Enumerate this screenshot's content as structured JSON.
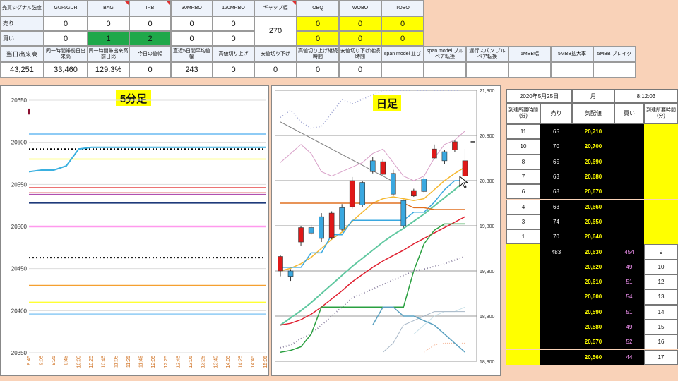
{
  "signal_table": {
    "col_headers": [
      "売買シグナル強度",
      "GUR/GDR",
      "BAG",
      "IRB",
      "30MRBO",
      "120MRBO",
      "ギャップ幅",
      "OBQ",
      "WOBO",
      "TOBO"
    ],
    "sell_label": "売り",
    "buy_label": "買い",
    "sell_values": [
      "0",
      "0",
      "0",
      "0",
      "0",
      "0",
      "0",
      "0"
    ],
    "buy_values": [
      "0",
      "1",
      "2",
      "0",
      "0",
      "0",
      "0",
      "0"
    ],
    "gap_value": "270",
    "row3_headers": [
      "当日出来高",
      "同一時間帯前日出来高",
      "同一時間帯出来高前日比",
      "今日の値幅",
      "直近5日間平均値幅",
      "高値切り上げ",
      "安値切り下げ",
      "高値切り上げ継続時間",
      "安値切り下げ継続時間",
      "span model 並び",
      "span model ブルベア転換",
      "遅行スパン ブルベア転換",
      "5MBB幅",
      "5MBB拡大率",
      "5MBB ブレイク"
    ],
    "row4_values": [
      "43,251",
      "33,460",
      "129.3%",
      "0",
      "243",
      "0",
      "0",
      "0",
      "0",
      "",
      "",
      "",
      "",
      "",
      ""
    ]
  },
  "chart5": {
    "title": "5分足",
    "y_ticks": [
      "20650",
      "20600",
      "20550",
      "20500",
      "20450",
      "20400",
      "20350"
    ],
    "x_ticks": [
      "8:45",
      "9:05",
      "9:25",
      "9:45",
      "10:05",
      "10:25",
      "10:45",
      "11:05",
      "11:25",
      "11:45",
      "12:05",
      "12:25",
      "12:45",
      "13:05",
      "13:25",
      "13:45",
      "14:05",
      "14:25",
      "14:45",
      "15:05"
    ],
    "ylim": [
      20350,
      20650
    ],
    "price_line": [
      [
        0,
        20565
      ],
      [
        1,
        20567
      ],
      [
        2,
        20567
      ],
      [
        3,
        20572
      ],
      [
        4,
        20592
      ],
      [
        5,
        20594
      ],
      [
        19,
        20594
      ]
    ],
    "levels": [
      {
        "y": 20610,
        "color": "#8ecbf5",
        "width": 3,
        "dash": ""
      },
      {
        "y": 20592,
        "color": "#000000",
        "width": 2,
        "dash": "2,3"
      },
      {
        "y": 20580,
        "color": "#ffff33",
        "width": 1.5,
        "dash": ""
      },
      {
        "y": 20546,
        "color": "#e02020",
        "width": 1.5,
        "dash": ""
      },
      {
        "y": 20540,
        "color": "#e07070",
        "width": 1.5,
        "dash": ""
      },
      {
        "y": 20538,
        "color": "#b050b0",
        "width": 1.5,
        "dash": ""
      },
      {
        "y": 20528,
        "color": "#1f3a7a",
        "width": 2,
        "dash": ""
      },
      {
        "y": 20500,
        "color": "#ff99ee",
        "width": 2.5,
        "dash": ""
      },
      {
        "y": 20463,
        "color": "#000000",
        "width": 2,
        "dash": "2,3"
      },
      {
        "y": 20430,
        "color": "#f5a030",
        "width": 1.5,
        "dash": ""
      },
      {
        "y": 20410,
        "color": "#ffff33",
        "width": 1.5,
        "dash": ""
      },
      {
        "y": 20396,
        "color": "#8ecbf5",
        "width": 1.5,
        "dash": ""
      }
    ]
  },
  "chart_day": {
    "title": "日足",
    "y_ticks": [
      "21,300",
      "20,800",
      "20,300",
      "19,800",
      "19,300",
      "18,800",
      "18,300"
    ],
    "ylim": [
      18300,
      21300
    ],
    "candles": [
      {
        "o": 19300,
        "c": 19460,
        "h": 19480,
        "l": 19240
      },
      {
        "o": 19300,
        "c": 19240,
        "h": 19320,
        "l": 19190
      },
      {
        "o": 19620,
        "c": 19780,
        "h": 19800,
        "l": 19580
      },
      {
        "o": 19780,
        "c": 19720,
        "h": 19810,
        "l": 19700
      },
      {
        "o": 19900,
        "c": 19660,
        "h": 19940,
        "l": 19620
      },
      {
        "o": 19670,
        "c": 19940,
        "h": 19960,
        "l": 19650
      },
      {
        "o": 20000,
        "c": 19760,
        "h": 20040,
        "l": 19740
      },
      {
        "o": 20010,
        "c": 20300,
        "h": 20340,
        "l": 19990
      },
      {
        "o": 20280,
        "c": 20030,
        "h": 20300,
        "l": 20010
      },
      {
        "o": 20520,
        "c": 20400,
        "h": 20560,
        "l": 20380
      },
      {
        "o": 20370,
        "c": 20510,
        "h": 20540,
        "l": 20350
      },
      {
        "o": 20380,
        "c": 20150,
        "h": 20420,
        "l": 20130
      },
      {
        "o": 20080,
        "c": 19800,
        "h": 20090,
        "l": 19780
      },
      {
        "o": 20130,
        "c": 20190,
        "h": 20210,
        "l": 20120
      },
      {
        "o": 20320,
        "c": 20180,
        "h": 20340,
        "l": 20170
      },
      {
        "o": 20550,
        "c": 20650,
        "h": 20700,
        "l": 20540
      },
      {
        "o": 20620,
        "c": 20520,
        "h": 20640,
        "l": 20480
      },
      {
        "o": 20640,
        "c": 20730,
        "h": 20750,
        "l": 20620
      },
      {
        "o": 20350,
        "c": 20520,
        "h": 20650,
        "l": 20330
      }
    ],
    "lines": [
      {
        "color": "#9aa0d0",
        "dash": "1,3",
        "w": 1.5,
        "y": [
          21000,
          21080,
          20950,
          20880,
          20900,
          21050,
          21200,
          21150,
          21200,
          21250,
          21300,
          21300,
          21300,
          21300,
          21300,
          21300,
          21300,
          21300,
          21300
        ]
      },
      {
        "color": "#d8a0c8",
        "dash": "",
        "w": 1,
        "y": [
          20500,
          20600,
          20700,
          20600,
          20400,
          20350,
          20400,
          20450,
          20500,
          20600,
          20650,
          20500,
          20350,
          20300,
          20350,
          20550,
          20700,
          20750,
          20850
        ]
      },
      {
        "color": "#f5b830",
        "dash": "",
        "w": 1.5,
        "y": [
          19300,
          19330,
          19380,
          19450,
          19550,
          19650,
          19730,
          19850,
          19950,
          20050,
          20100,
          20120,
          20100,
          20080,
          20100,
          20200,
          20300,
          20380,
          20450
        ]
      },
      {
        "color": "#ffffff",
        "dash": "",
        "w": 0,
        "y": [
          19300,
          19330,
          19380,
          19450,
          19550,
          19650,
          19730,
          19850,
          19950,
          20050,
          20100,
          20120,
          20100,
          20080,
          20100,
          20200,
          20300,
          20380,
          20450
        ]
      },
      {
        "color": "#3aa8e0",
        "dash": "",
        "w": 1.5,
        "y": [
          19340,
          19340,
          19340,
          19500,
          19500,
          19700,
          19700,
          19860,
          19860,
          19860,
          19860,
          19860,
          19860,
          19950,
          19950,
          20060,
          20200,
          20300,
          20300
        ]
      },
      {
        "color": "#60c8a0",
        "dash": "",
        "w": 2,
        "y": [
          18700,
          18780,
          18860,
          18950,
          19050,
          19150,
          19250,
          19350,
          19440,
          19530,
          19620,
          19700,
          19770,
          19850,
          19930,
          20020,
          20110,
          20200,
          20300
        ]
      },
      {
        "color": "#e02030",
        "dash": "",
        "w": 1.5,
        "y": [
          18700,
          18720,
          18760,
          18820,
          18900,
          18990,
          19080,
          19180,
          19260,
          19340,
          19410,
          19470,
          19530,
          19600,
          19660,
          19720,
          19780,
          19840,
          19900
        ]
      },
      {
        "color": "#2aa040",
        "dash": "",
        "w": 1.5,
        "y": [
          18400,
          18420,
          18460,
          18600,
          18900,
          18900,
          18900,
          18900,
          18900,
          18900,
          18900,
          18900,
          18900,
          19300,
          19600,
          19750,
          19820,
          19820,
          19820
        ]
      },
      {
        "color": "#e07020",
        "dash": "",
        "w": 1.5,
        "y": [
          20050,
          20050,
          20050,
          20050,
          20050,
          20050,
          20050,
          20050,
          20050,
          20050,
          20050,
          20050,
          20050,
          20000,
          20000,
          19980,
          19980,
          19980,
          19980
        ]
      },
      {
        "color": "#8a80a0",
        "dash": "1,3",
        "w": 2,
        "y": [
          18450,
          18480,
          18550,
          18600,
          18700,
          18800,
          18900,
          19000,
          19050,
          19100,
          19150,
          19200,
          19250,
          19300,
          19320,
          19350,
          19380,
          19420,
          19460
        ]
      },
      {
        "color": "#f5b090",
        "dash": "1,2",
        "w": 1,
        "y": [
          null,
          null,
          null,
          null,
          null,
          null,
          null,
          null,
          null,
          null,
          null,
          null,
          null,
          null,
          18400,
          18480,
          18500,
          18500,
          18500
        ]
      },
      {
        "color": "#c8e0e8",
        "dash": "",
        "w": 1,
        "y": [
          null,
          null,
          null,
          null,
          null,
          null,
          null,
          null,
          null,
          null,
          null,
          null,
          null,
          18600,
          18700,
          18800,
          18850,
          18850,
          18900
        ]
      },
      {
        "color": "#a8b8c8",
        "dash": "",
        "w": 1,
        "y": [
          null,
          null,
          null,
          null,
          null,
          null,
          null,
          null,
          null,
          null,
          18400,
          18500,
          18700,
          18750,
          18800,
          18850,
          18850,
          18850,
          18850
        ]
      },
      {
        "color": "#5aa0c0",
        "dash": "",
        "w": 1.5,
        "y": [
          null,
          null,
          null,
          null,
          null,
          null,
          null,
          null,
          null,
          18700,
          18900,
          18900,
          18800,
          18800,
          18750,
          18700,
          18600,
          18500,
          18400
        ]
      },
      {
        "color": "#808080",
        "dash": "",
        "w": 1,
        "y": [
          20950,
          20890,
          20830,
          20770,
          20710,
          20650,
          20590,
          20530,
          20470,
          20410,
          20350,
          20290,
          null,
          null,
          null,
          null,
          null,
          null,
          null
        ]
      }
    ]
  },
  "board": {
    "date": "2020年5月25日",
    "weekday": "月",
    "time": "8:12:03",
    "col_headers": [
      "到達所要時間(分)",
      "売り",
      "気配値",
      "買い",
      "到達所要時間(分)"
    ],
    "ask_rows": [
      {
        "time": "11",
        "sell": "65",
        "price": "20,710"
      },
      {
        "time": "10",
        "sell": "70",
        "price": "20,700"
      },
      {
        "time": "8",
        "sell": "65",
        "price": "20,690"
      },
      {
        "time": "7",
        "sell": "63",
        "price": "20,680"
      },
      {
        "time": "6",
        "sell": "68",
        "price": "20,670"
      },
      {
        "time": "4",
        "sell": "63",
        "price": "20,660"
      },
      {
        "time": "3",
        "sell": "74",
        "price": "20,650"
      },
      {
        "time": "1",
        "sell": "70",
        "price": "20,640"
      }
    ],
    "bid_rows": [
      {
        "sell": "483",
        "price": "20,630",
        "buy": "454",
        "time": "9"
      },
      {
        "sell": "",
        "price": "20,620",
        "buy": "49",
        "time": "10"
      },
      {
        "sell": "",
        "price": "20,610",
        "buy": "51",
        "time": "12"
      },
      {
        "sell": "",
        "price": "20,600",
        "buy": "54",
        "time": "13"
      },
      {
        "sell": "",
        "price": "20,590",
        "buy": "51",
        "time": "14"
      },
      {
        "sell": "",
        "price": "20,580",
        "buy": "49",
        "time": "15"
      },
      {
        "sell": "",
        "price": "20,570",
        "buy": "52",
        "time": "16"
      },
      {
        "sell": "",
        "price": "20,560",
        "buy": "44",
        "time": "17"
      }
    ]
  }
}
